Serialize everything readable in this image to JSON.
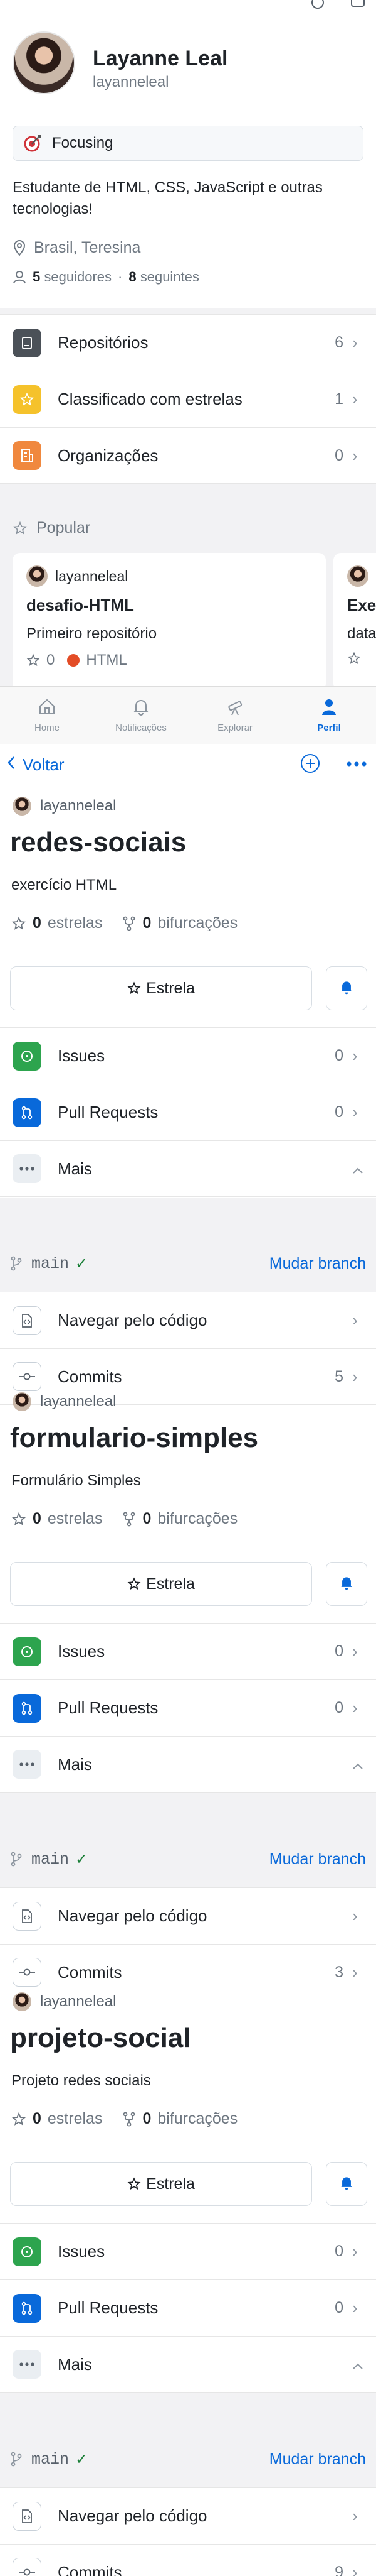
{
  "profile": {
    "name": "Layanne Leal",
    "username": "layanneleal",
    "status": "Focusing",
    "bio": "Estudante de HTML, CSS, JavaScript e outras tecnologias!",
    "location": "Brasil, Teresina",
    "followers_count": "5",
    "followers_label": "seguidores",
    "separator": "·",
    "following_count": "8",
    "following_label": "seguintes"
  },
  "profile_menu": [
    {
      "label": "Repositórios",
      "count": "6",
      "icon": "repo-icon",
      "color": "#57606a"
    },
    {
      "label": "Classificado com estrelas",
      "count": "1",
      "icon": "star-icon",
      "color": "#f5c22b"
    },
    {
      "label": "Organizações",
      "count": "0",
      "icon": "organization-icon",
      "color": "#f0883e"
    }
  ],
  "popular": {
    "heading": "Popular",
    "cards": [
      {
        "owner": "layanneleal",
        "name": "desafio-HTML",
        "description": "Primeiro repositório",
        "stars": "0",
        "language": "HTML",
        "language_color": "#e34c26"
      },
      {
        "owner": "",
        "name": "Exe",
        "description": "data",
        "stars": "",
        "language": "",
        "language_color": "#e34c26"
      }
    ]
  },
  "tabbar": [
    {
      "label": "Home",
      "icon": "home-icon"
    },
    {
      "label": "Notificações",
      "icon": "bell-icon"
    },
    {
      "label": "Explorar",
      "icon": "telescope-icon"
    },
    {
      "label": "Perfil",
      "icon": "person-icon"
    }
  ],
  "nav": {
    "back_label": "Voltar"
  },
  "repos": [
    {
      "owner": "layanneleal",
      "name": "redes-sociais",
      "description": "exercício HTML",
      "stars": "0",
      "stars_label": "estrelas",
      "forks": "0",
      "forks_label": "bifurcações",
      "star_button": "Estrela",
      "issues": "0",
      "pulls": "0",
      "branch": "main",
      "commits": "5"
    },
    {
      "owner": "layanneleal",
      "name": "formulario-simples",
      "description": "Formulário Simples",
      "stars": "0",
      "stars_label": "estrelas",
      "forks": "0",
      "forks_label": "bifurcações",
      "star_button": "Estrela",
      "issues": "0",
      "pulls": "0",
      "branch": "main",
      "commits": "3"
    },
    {
      "owner": "layanneleal",
      "name": "projeto-social",
      "description": "Projeto redes sociais",
      "stars": "0",
      "stars_label": "estrelas",
      "forks": "0",
      "forks_label": "bifurcações",
      "star_button": "Estrela",
      "issues": "0",
      "pulls": "0",
      "branch": "main",
      "commits": "9"
    }
  ],
  "repo_labels": {
    "issues": "Issues",
    "pulls": "Pull Requests",
    "more": "Mais",
    "change_branch": "Mudar branch",
    "browse_code": "Navegar pelo código",
    "commits": "Commits"
  },
  "colors": {
    "accent": "#0969da",
    "issues": "#2da44e",
    "pulls": "#0969da",
    "check": "#1a7f37"
  }
}
